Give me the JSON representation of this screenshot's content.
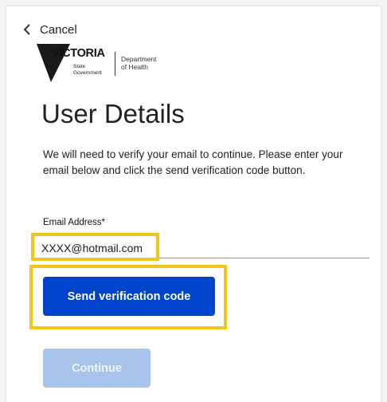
{
  "nav": {
    "cancel_label": "Cancel"
  },
  "logo": {
    "wordmark": "VICTORIA",
    "sub_line1": "State",
    "sub_line2": "Government",
    "dept_line1": "Department",
    "dept_line2": "of Health"
  },
  "page": {
    "title": "User Details",
    "instructions": "We will need to verify your email to continue. Please enter your email below and click the send verification code button."
  },
  "form": {
    "email_label": "Email Address*",
    "email_value": "XXXX@hotmail.com"
  },
  "buttons": {
    "send_label": "Send verification code",
    "continue_label": "Continue"
  },
  "colors": {
    "primary": "#0044cc",
    "disabled": "#a9c4ec",
    "highlight": "#f2c51c"
  }
}
